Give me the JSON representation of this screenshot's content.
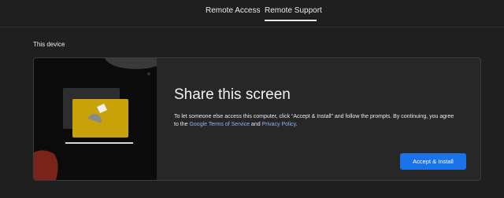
{
  "nav": {
    "tabs": [
      {
        "label": "Remote Access"
      },
      {
        "label": "Remote Support"
      }
    ]
  },
  "section": {
    "label": "This device"
  },
  "share": {
    "title": "Share this screen",
    "body_prefix": "To let someone else access this computer, click “Accept & Install” and follow the prompts. By continuing, you agree to the ",
    "tos_link": "Google Terms of Service",
    "and_text": " and ",
    "privacy_link": "Privacy Policy",
    "body_suffix": ".",
    "button_label": "Accept & Install"
  },
  "colors": {
    "accent": "#1a73e8",
    "link": "#8ab4f8",
    "illustration_yellow": "#c9a20a",
    "illustration_red": "#7a2318"
  }
}
